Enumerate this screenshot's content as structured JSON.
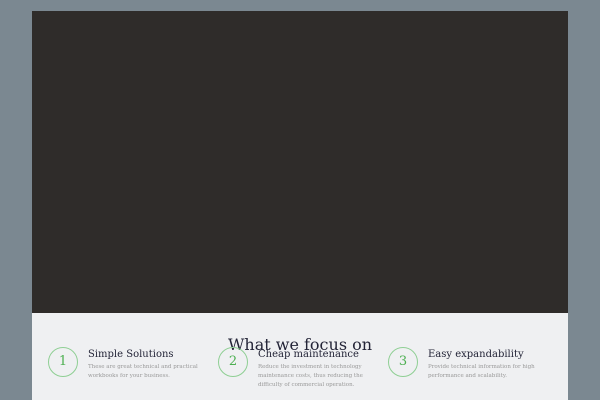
{
  "section_title": "What we focus on",
  "items": [
    {
      "num": "1",
      "title": "Simple Solutions",
      "desc": "These are great technical and practical workbooks for your business."
    },
    {
      "num": "2",
      "title": "Cheap maintenance",
      "desc": "Reduce the investment in technology maintenance costs, thus reducing the difficulty of commercial operation."
    },
    {
      "num": "3",
      "title": "Easy expandability",
      "desc": "Provide technical information for high performance and scalability."
    }
  ]
}
